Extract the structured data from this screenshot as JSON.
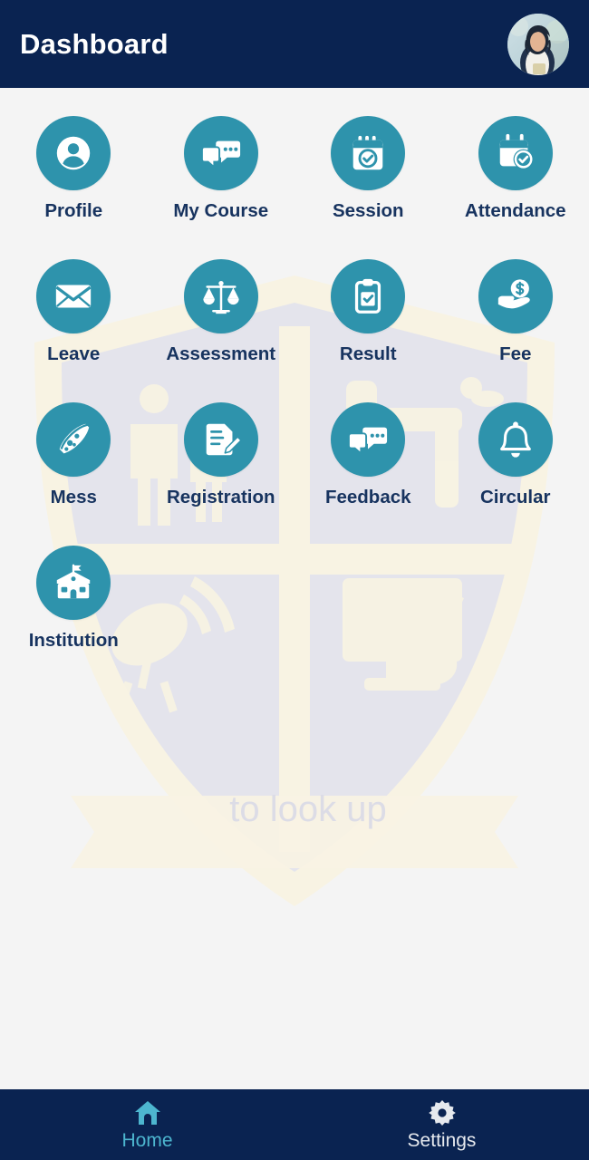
{
  "header": {
    "title": "Dashboard",
    "avatar_name": "user-avatar",
    "background_color": "#0a2351",
    "title_color": "#ffffff"
  },
  "theme": {
    "accent_circle": "#2e93ac",
    "label_color": "#17335f",
    "page_background": "#f4f4f4",
    "nav_active_color": "#4db6cf",
    "nav_inactive_color": "#e6e9ee"
  },
  "watermark": {
    "text": "to look up",
    "shield_fill": "#e4e4ec",
    "shield_border": "#f7f2e2"
  },
  "grid": {
    "tiles": [
      {
        "label": "Profile",
        "icon": "person-circle-icon"
      },
      {
        "label": "My Course",
        "icon": "chat-bubbles-icon"
      },
      {
        "label": "Session",
        "icon": "calendar-check-icon"
      },
      {
        "label": "Attendance",
        "icon": "calendar-clock-check-icon"
      },
      {
        "label": "Leave",
        "icon": "envelope-icon"
      },
      {
        "label": "Assessment",
        "icon": "balance-scale-icon"
      },
      {
        "label": "Result",
        "icon": "clipboard-check-icon"
      },
      {
        "label": "Fee",
        "icon": "hand-money-icon"
      },
      {
        "label": "Mess",
        "icon": "pizza-slice-icon"
      },
      {
        "label": "Registration",
        "icon": "document-pencil-icon"
      },
      {
        "label": "Feedback",
        "icon": "chat-bubbles-icon"
      },
      {
        "label": "Circular",
        "icon": "bell-icon"
      },
      {
        "label": "Institution",
        "icon": "school-building-icon"
      }
    ]
  },
  "bottom_nav": {
    "items": [
      {
        "label": "Home",
        "icon": "home-icon",
        "active": true
      },
      {
        "label": "Settings",
        "icon": "gear-icon",
        "active": false
      }
    ]
  }
}
